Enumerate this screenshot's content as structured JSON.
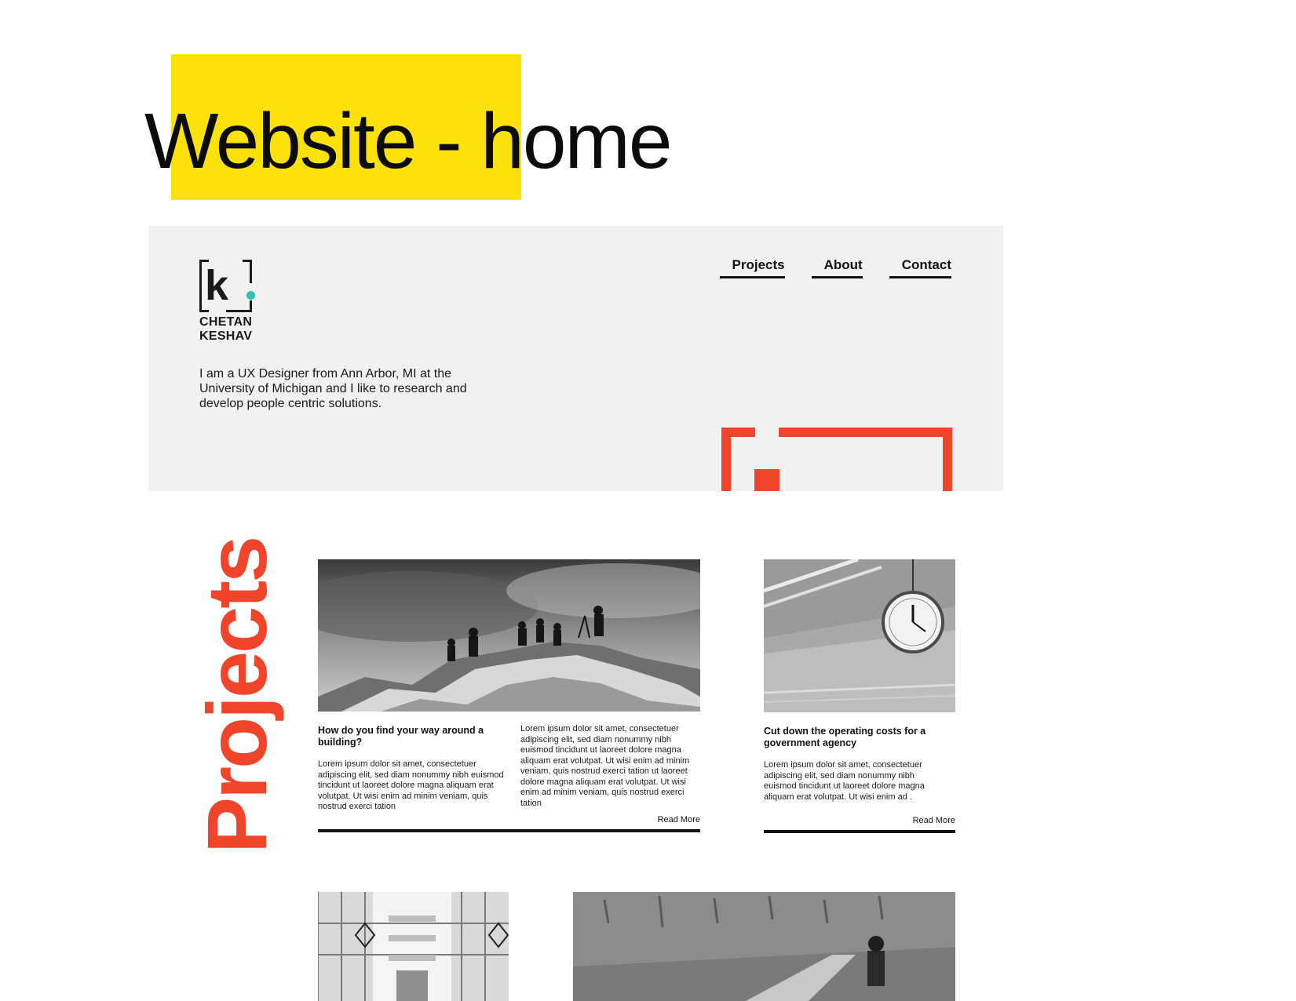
{
  "page_title": "Website - home",
  "colors": {
    "highlight": "#fce10a",
    "accent": "#f0452b",
    "logo_dot": "#2ec4a9",
    "hero_bg": "#f1f1f1"
  },
  "header": {
    "logo_letter": "k",
    "logo_name_line1": "CHETAN",
    "logo_name_line2": "KESHAV",
    "nav": [
      {
        "label": "Projects"
      },
      {
        "label": "About"
      },
      {
        "label": "Contact"
      }
    ],
    "intro": "I am a UX Designer from Ann Arbor, MI at the University of Michigan and I like to research and develop people centric solutions."
  },
  "projects_heading": "Projects",
  "projects": [
    {
      "title": "How do you find your way around a building?",
      "text_col1": "Lorem ipsum dolor sit amet, consectetuer adipiscing elit, sed diam nonummy nibh euismod tincidunt ut laoreet dolore magna aliquam erat volutpat. Ut wisi enim ad minim veniam, quis nostrud exerci tation",
      "text_col2": "Lorem ipsum dolor sit amet, consectetuer adipiscing elit, sed diam nonummy nibh euismod tincidunt ut laoreet dolore magna aliquam erat volutpat. Ut wisi enim ad minim veniam, quis nostrud exerci tation ut laoreet dolore magna aliquam erat volutpat. Ut wisi enim ad minim veniam, quis nostrud exerci tation",
      "read_more": "Read More",
      "image": "hikers-on-rocks-photo"
    },
    {
      "title": "Cut down the operating costs for a government agency",
      "text": "Lorem ipsum dolor sit amet, consectetuer adipiscing elit, sed diam nonummy nibh euismod tincidunt ut laoreet dolore magna aliquam erat volutpat. Ut wisi enim ad .",
      "read_more": "Read More",
      "image": "ceiling-clock-photo"
    },
    {
      "image": "atrium-building-photo"
    },
    {
      "image": "person-by-wall-photo"
    }
  ]
}
